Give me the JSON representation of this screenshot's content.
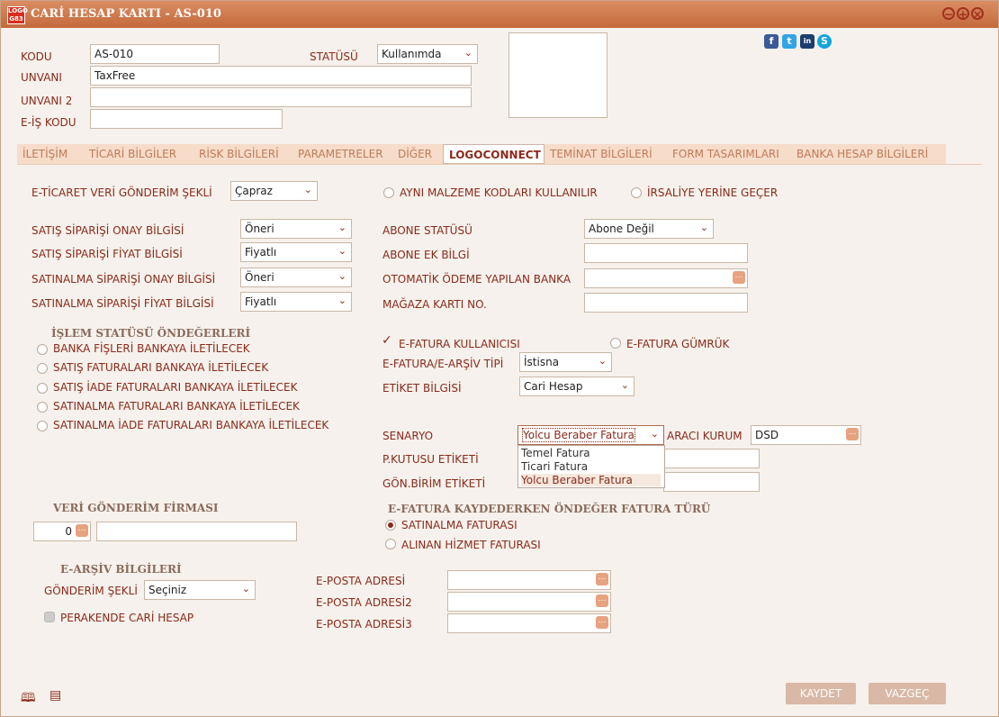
{
  "window": {
    "title": "CARİ HESAP KARTI - AS-010",
    "app_icon_text": "LOGO G83"
  },
  "header": {
    "kodu_label": "KODU",
    "kodu_value": "AS-010",
    "statusu_label": "STATÜSÜ",
    "statusu_value": "Kullanımda",
    "unvani_label": "UNVANI",
    "unvani_value": "TaxFree",
    "unvani2_label": "UNVANI 2",
    "unvani2_value": "",
    "eis_label": "E-İŞ KODU",
    "eis_value": ""
  },
  "social": [
    "f",
    "t",
    "in",
    "S"
  ],
  "tabs": [
    "İLETİŞİM",
    "TİCARİ BİLGİLER",
    "RİSK BİLGİLERİ",
    "PARAMETRELER",
    "DİĞER",
    "LOGOCONNECT",
    "TEMİNAT BİLGİLERİ",
    "FORM TASARIMLARI",
    "BANKA HESAP BİLGİLERİ"
  ],
  "active_tab": "LOGOCONNECT",
  "left": {
    "eticaret_label": "E-TİCARET VERİ GÖNDERİM ŞEKLİ",
    "eticaret_value": "Çapraz",
    "satis_onay_label": "SATIŞ SİPARİŞİ ONAY BİLGİSİ",
    "satis_onay_value": "Öneri",
    "satis_fiyat_label": "SATIŞ SİPARİŞİ FİYAT BİLGİSİ",
    "satis_fiyat_value": "Fiyatlı",
    "satinalma_onay_label": "SATINALMA SİPARİŞİ ONAY BİLGİSİ",
    "satinalma_onay_value": "Öneri",
    "satinalma_fiyat_label": "SATINALMA SİPARİŞİ FİYAT BİLGİSİ",
    "satinalma_fiyat_value": "Fiyatlı",
    "islem_title": "İŞLEM STATÜSÜ ÖNDEĞERLERİ",
    "islem_items": [
      "BANKA FİŞLERİ BANKAYA İLETİLECEK",
      "SATIŞ FATURALARI BANKAYA İLETİLECEK",
      "SATIŞ İADE FATURALARI BANKAYA İLETİLECEK",
      "SATINALMA FATURALARI BANKAYA İLETİLECEK",
      "SATINALMA İADE FATURALARI BANKAYA İLETİLECEK"
    ],
    "veri_title": "VERİ GÖNDERİM FİRMASI",
    "veri_value": "0",
    "earsiv_title": "E-ARŞİV BİLGİLERİ",
    "gonderim_label": "GÖNDERİM ŞEKLİ",
    "gonderim_value": "Seçiniz",
    "perakende_label": "PERAKENDE CARİ HESAP"
  },
  "right": {
    "ayni_malzeme": "AYNI MALZEME KODLARI KULLANILIR",
    "irsaliye": "İRSALİYE YERİNE GEÇER",
    "abone_statu_label": "ABONE STATÜSÜ",
    "abone_statu_value": "Abone Değil",
    "abone_ek_label": "ABONE EK BİLGİ",
    "otomatik_label": "OTOMATİK ÖDEME YAPILAN BANKA",
    "magaza_label": "MAĞAZA KARTI NO.",
    "efatura_kullanici": "E-FATURA KULLANICISI",
    "efatura_gumruk": "E-FATURA GÜMRÜK",
    "efatura_tipi_label": "E-FATURA/E-ARŞİV TİPİ",
    "efatura_tipi_value": "İstisna",
    "etiket_label": "ETİKET BİLGİSİ",
    "etiket_value": "Cari Hesap",
    "senaryo_label": "SENARYO",
    "senaryo_value": "Yolcu Beraber Fatura",
    "senaryo_options": [
      "Temel Fatura",
      "Ticari Fatura",
      "Yolcu Beraber Fatura"
    ],
    "araci_label": "ARACI KURUM",
    "araci_value": "DSD",
    "pkutusu_label": "P.KUTUSU ETİKETİ",
    "gonbirim_label": "GÖN.BİRİM ETİKETİ",
    "kaydederken_title": "E-FATURA KAYDEDERKEN ÖNDEĞER FATURA TÜRÜ",
    "satinalma_faturasi": "SATINALMA FATURASI",
    "alinan_hizmet": "ALINAN HİZMET FATURASI",
    "eposta1": "E-POSTA ADRESİ",
    "eposta2": "E-POSTA ADRESİ2",
    "eposta3": "E-POSTA ADRESİ3"
  },
  "footer": {
    "kaydet": "KAYDET",
    "vazgec": "VAZGEÇ"
  },
  "colors": {
    "title_bar": "#c4693c",
    "label": "#8a2a1a",
    "tab_bg": "#f6dcc9",
    "button": "#d9b8a6"
  }
}
